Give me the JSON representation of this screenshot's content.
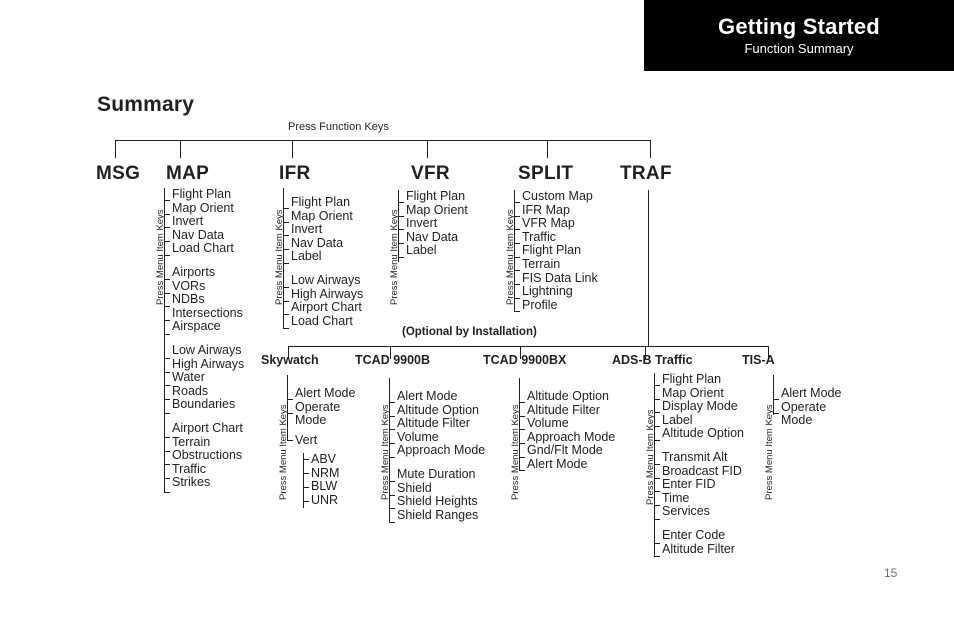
{
  "header": {
    "title": "Getting Started",
    "subtitle": "Function Summary",
    "bar_color": "#000000",
    "text_color": "#ffffff"
  },
  "page": {
    "title": "Summary",
    "number": "15"
  },
  "diagram": {
    "top_caption": "Press Function Keys",
    "optional_note": "(Optional by Installation)",
    "menu_caption": "Press Menu Item Keys",
    "function_keys": [
      {
        "label": "MSG",
        "groups": []
      },
      {
        "label": "MAP",
        "groups": [
          [
            "Flight Plan",
            "Map Orient",
            "Invert",
            "Nav Data",
            "Load Chart"
          ],
          [
            "Airports",
            "VORs",
            "NDBs",
            "Intersections",
            "Airspace"
          ],
          [
            "Low Airways",
            "High Airways",
            "Water",
            "Roads",
            "Boundaries"
          ],
          [
            "Airport Chart",
            "Terrain",
            "Obstructions",
            "Traffic",
            "Strikes"
          ]
        ]
      },
      {
        "label": "IFR",
        "groups": [
          [
            "Flight Plan",
            "Map Orient",
            "Invert",
            "Nav Data",
            "Label"
          ],
          [
            "Low Airways",
            "High Airways",
            "Airport Chart",
            "Load Chart"
          ]
        ]
      },
      {
        "label": "VFR",
        "groups": [
          [
            "Flight Plan",
            "Map Orient",
            "Invert",
            "Nav Data",
            "Label"
          ]
        ]
      },
      {
        "label": "SPLIT",
        "groups": [
          [
            "Custom Map",
            "IFR Map",
            "VFR Map",
            "Traffic",
            "Flight Plan",
            "Terrain",
            "FIS Data Link",
            "Lightning",
            "Profile"
          ]
        ]
      },
      {
        "label": "TRAF",
        "groups": []
      }
    ],
    "optional_systems": [
      {
        "label": "Skywatch",
        "groups": [
          [
            "Alert Mode",
            "Operate\nMode"
          ],
          [
            "Vert"
          ]
        ],
        "sub_branch": {
          "parent": "Vert",
          "items": [
            "ABV",
            "NRM",
            "BLW",
            "UNR"
          ]
        }
      },
      {
        "label": "TCAD 9900B",
        "groups": [
          [
            "Alert Mode",
            "Altitude Option",
            "Altitude Filter",
            "Volume",
            "Approach Mode"
          ],
          [
            "Mute Duration",
            "Shield",
            "Shield Heights",
            "Shield Ranges"
          ]
        ]
      },
      {
        "label": "TCAD 9900BX",
        "groups": [
          [
            "Altitude Option",
            "Altitude Filter",
            "Volume",
            "Approach Mode",
            "Gnd/Flt Mode",
            "Alert Mode"
          ]
        ]
      },
      {
        "label": "ADS-B Traffic",
        "groups": [
          [
            "Flight Plan",
            "Map Orient",
            "Display Mode",
            "Label",
            "Altitude Option"
          ],
          [
            "Transmit Alt",
            "Broadcast FID",
            "Enter FID",
            "Time",
            "Services"
          ],
          [
            "Enter Code",
            "Altitude Filter"
          ]
        ]
      },
      {
        "label": "TIS-A",
        "groups": [
          [
            "Alert Mode",
            "Operate\nMode"
          ]
        ]
      }
    ]
  }
}
